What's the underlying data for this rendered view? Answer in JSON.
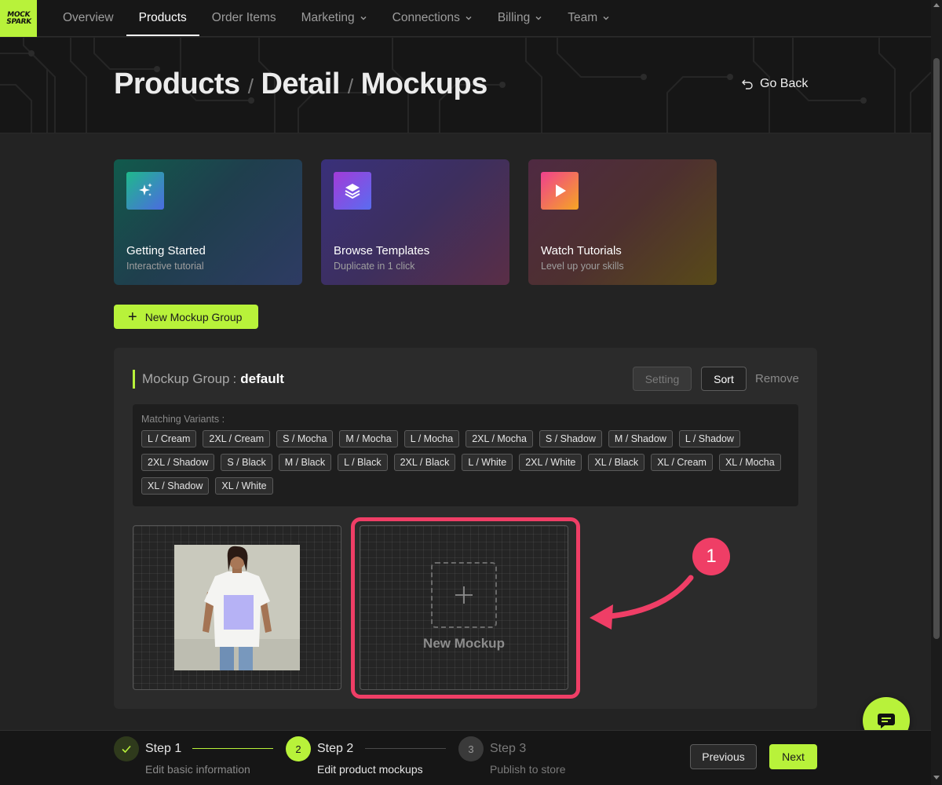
{
  "logo": {
    "line1": "MOCK",
    "line2": "SPARK"
  },
  "nav": {
    "items": [
      {
        "label": "Overview",
        "active": false,
        "dropdown": false
      },
      {
        "label": "Products",
        "active": true,
        "dropdown": false
      },
      {
        "label": "Order Items",
        "active": false,
        "dropdown": false
      },
      {
        "label": "Marketing",
        "active": false,
        "dropdown": true
      },
      {
        "label": "Connections",
        "active": false,
        "dropdown": true
      },
      {
        "label": "Billing",
        "active": false,
        "dropdown": true
      },
      {
        "label": "Team",
        "active": false,
        "dropdown": true
      }
    ]
  },
  "header": {
    "breadcrumb": [
      "Products",
      "Detail",
      "Mockups"
    ],
    "separator": "/",
    "go_back": "Go Back",
    "go_back_icon": "undo-arrow-icon"
  },
  "cards": [
    {
      "title": "Getting Started",
      "subtitle": "Interactive tutorial",
      "icon": "sparkles-icon"
    },
    {
      "title": "Browse Templates",
      "subtitle": "Duplicate in 1 click",
      "icon": "layers-icon"
    },
    {
      "title": "Watch Tutorials",
      "subtitle": "Level up your skills",
      "icon": "play-icon"
    }
  ],
  "new_group_button": {
    "icon": "+",
    "label": "New Mockup Group"
  },
  "group": {
    "title_label": "Mockup Group",
    "colon": ":",
    "name": "default",
    "setting_label": "Setting",
    "sort_label": "Sort",
    "remove_label": "Remove",
    "variants_label": "Matching Variants :",
    "variants": [
      "L / Cream",
      "2XL / Cream",
      "S / Mocha",
      "M / Mocha",
      "L / Mocha",
      "2XL / Mocha",
      "S / Shadow",
      "M / Shadow",
      "L / Shadow",
      "2XL / Shadow",
      "S / Black",
      "M / Black",
      "L / Black",
      "2XL / Black",
      "L / White",
      "2XL / White",
      "XL / Black",
      "XL / Cream",
      "XL / Mocha",
      "XL / Shadow",
      "XL / White"
    ],
    "new_mockup_label": "New Mockup"
  },
  "annotation": {
    "badge": "1",
    "color": "#ef3e66"
  },
  "stepper": {
    "steps": [
      {
        "title": "Step 1",
        "desc": "Edit basic information",
        "state": "done",
        "num": "1"
      },
      {
        "title": "Step 2",
        "desc": "Edit product mockups",
        "state": "current",
        "num": "2"
      },
      {
        "title": "Step 3",
        "desc": "Publish to store",
        "state": "pending",
        "num": "3"
      }
    ],
    "prev_label": "Previous",
    "next_label": "Next"
  },
  "colors": {
    "accent": "#b8f23a",
    "background": "#232323",
    "highlight": "#ef3e66"
  }
}
